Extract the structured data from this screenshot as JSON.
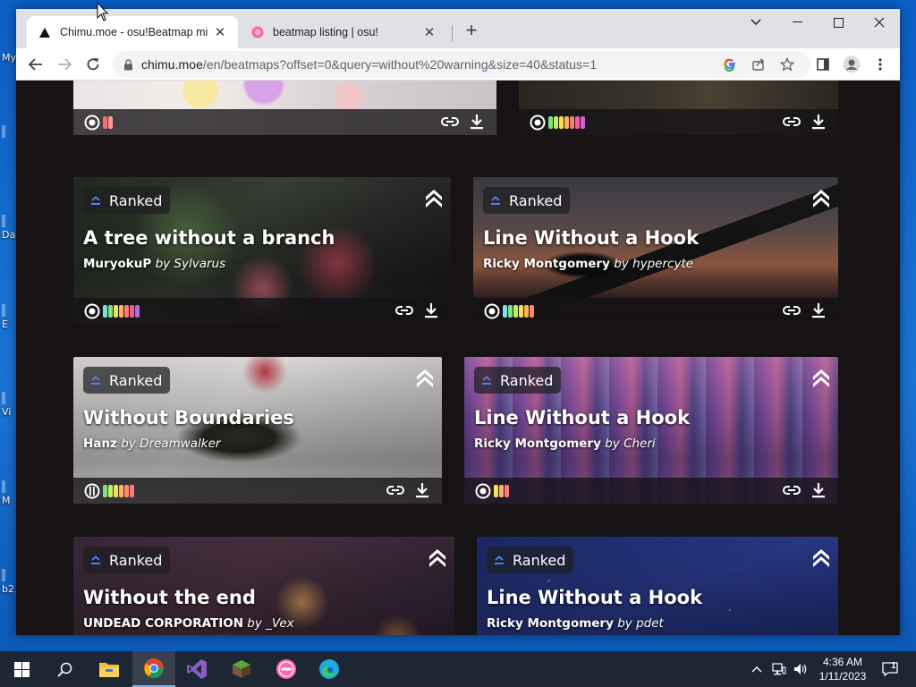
{
  "desktop": {
    "icons": [
      "My",
      "Da",
      "E",
      "Vi",
      "M",
      "b2"
    ]
  },
  "browser": {
    "tabs": [
      {
        "title": "Chimu.moe - osu!Beatmap mirror",
        "active": true
      },
      {
        "title": "beatmap listing | osu!",
        "active": false
      }
    ],
    "new_tab": "+",
    "url_host": "chimu.moe",
    "url_path": "/en/beatmaps?offset=0&query=without%20warning&size=40&status=1"
  },
  "page": {
    "top_row": [
      {
        "diffs": [
          "#ff6b6b",
          "#ff9a9a"
        ]
      },
      {
        "diffs": [
          "#7ee37e",
          "#c9ee5c",
          "#f5e05a",
          "#ffb35c",
          "#ff7a7a",
          "#f75a9e",
          "#d95ad6"
        ]
      }
    ],
    "cards": [
      {
        "status": "Ranked",
        "title": "A tree without a branch",
        "artist": "MuryokuP",
        "by": "by",
        "mapper": "Sylvarus",
        "diffs": [
          "#7fdde6",
          "#7ee37e",
          "#f5e05a",
          "#ffb35c",
          "#ff7a7a",
          "#f75a9e",
          "#b56ad8"
        ]
      },
      {
        "status": "Ranked",
        "title": "Line Without a Hook",
        "artist": "Ricky Montgomery",
        "by": "by",
        "mapper": "hypercyte",
        "diffs": [
          "#7fdde6",
          "#7ee37e",
          "#c9ee5c",
          "#f5e05a",
          "#ffb35c",
          "#ff8a6a"
        ]
      },
      {
        "status": "Ranked",
        "title": "Without Boundaries",
        "artist": "Hanz",
        "by": "by",
        "mapper": "Dreamwalker",
        "diffs": [
          "#7ee37e",
          "#c9ee5c",
          "#f5e05a",
          "#ffb35c",
          "#ff8a6a",
          "#ff7a7a"
        ]
      },
      {
        "status": "Ranked",
        "title": "Line Without a Hook",
        "artist": "Ricky Montgomery",
        "by": "by",
        "mapper": "Cheri",
        "diffs": [
          "#f5e05a",
          "#ffb35c",
          "#ff7a7a"
        ]
      },
      {
        "status": "Ranked",
        "title": "Without the end",
        "artist": "UNDEAD CORPORATION",
        "by": "by",
        "mapper": "_Vex"
      },
      {
        "status": "Ranked",
        "title": "Line Without a Hook",
        "artist": "Ricky Montgomery",
        "by": "by",
        "mapper": "pdet"
      }
    ]
  },
  "taskbar": {
    "time": "4:36 AM",
    "date": "1/11/2023",
    "notifications": "1"
  },
  "colors": {
    "accent_badge": "#4a8cff",
    "tab_strip": "#dfe1e5",
    "page_bg": "#171314"
  }
}
